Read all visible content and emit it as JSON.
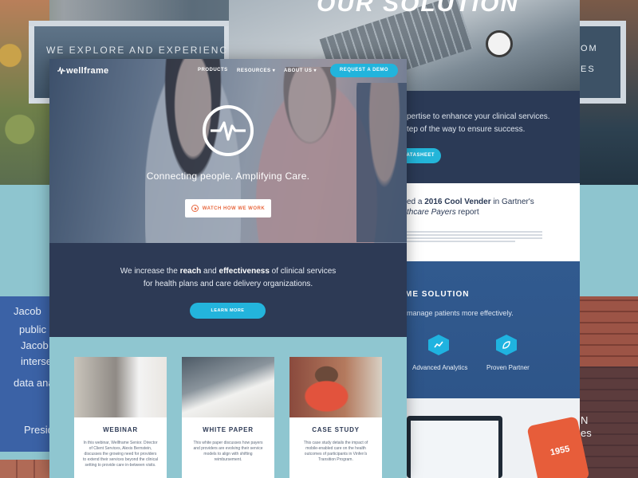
{
  "background": {
    "frame_left_text": "WE EXPLORE AND EXPERIENCE",
    "frame_right_text_1": "OM",
    "frame_right_text_2": "ES",
    "jacob_lines": [
      "Jacob",
      "public",
      "Jacob",
      "interse",
      "data ana"
    ],
    "jacob_footer": "Presid"
  },
  "back_page": {
    "hero_title": "OUR SOLUTION",
    "intro_line_1": "pertise to enhance your clinical services.",
    "intro_line_2": "tep of the way to ensure success.",
    "datasheet_button": "ATASHEET",
    "award_line_1_prefix": "ed a ",
    "award_line_1_bold": "2016 Cool Vender",
    "award_line_1_suffix": " in Gartner's",
    "award_line_2": "thcare Payers",
    "award_line_2_suffix": " report",
    "solution_title": "ME SOLUTION",
    "solution_subtitle": "manage patients more effectively.",
    "features": [
      {
        "label": "Advanced Analytics",
        "icon": "chart-icon"
      },
      {
        "label": "Proven Partner",
        "icon": "leaf-icon"
      }
    ],
    "phone_value": "1955",
    "right_edge_text": "N",
    "right_edge_text_2": "es"
  },
  "main_page": {
    "logo": "wellframe",
    "nav": [
      "PRODUCTS",
      "RESOURCES",
      "ABOUT US"
    ],
    "demo_button": "REQUEST A DEMO",
    "tagline": "Connecting people. Amplifying Care.",
    "watch_button": "WATCH HOW WE WORK",
    "mission": {
      "line1_a": "We increase the ",
      "line1_b": "reach",
      "line1_c": " and ",
      "line1_d": "effectiveness",
      "line1_e": " of clinical services",
      "line2": "for health plans and care delivery organizations."
    },
    "learn_button": "LEARN MORE",
    "cards": [
      {
        "title": "WEBINAR",
        "desc": "In this webinar, Wellframe Senior. Director of Client Services, Alexis Bernstein, discusses the growing need for providers to extend their services beyond the clinical setting to provide care in-between visits."
      },
      {
        "title": "WHITE PAPER",
        "desc": "This white paper discusses how payers and providers are evolving their service models to align with shifting reimbursement."
      },
      {
        "title": "CASE STUDY",
        "desc": "This case study details the impact of mobile-enabled care on the health outcomes of participants in Vinfen's Transition Program."
      }
    ]
  },
  "colors": {
    "accent": "#22b4dc",
    "navy": "#2d3a55",
    "teal_bg": "#8fc6d0",
    "orange": "#e8683f"
  }
}
